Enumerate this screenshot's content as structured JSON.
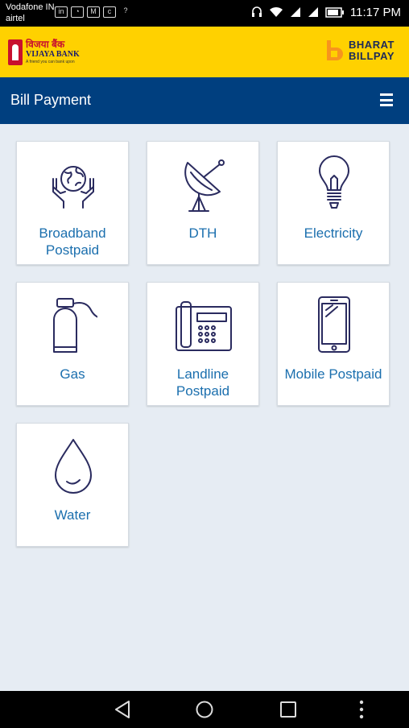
{
  "status_bar": {
    "carrier_line1": "Vodafone IN",
    "carrier_line2": "airtel",
    "time": "11:17 PM",
    "notification_icons": [
      "linkedin-icon",
      "whatsapp-icon",
      "gmail-icon",
      "citi-icon",
      "wifi-question-icon"
    ],
    "system_icons": [
      "headset-icon",
      "wifi-icon",
      "signal-icon",
      "signal-icon",
      "battery-icon"
    ]
  },
  "brand": {
    "bank_name_hindi": "विजया बैंक",
    "bank_name": "VIJAYA BANK",
    "bank_tagline": "A friend you can bank upon",
    "bbps_line1": "BHARAT",
    "bbps_line2": "BILLPAY"
  },
  "header": {
    "title": "Bill Payment",
    "menu_icon": "hamburger-menu-icon"
  },
  "categories": [
    {
      "label": "Broadband Postpaid",
      "icon": "globe-hands-icon"
    },
    {
      "label": "DTH",
      "icon": "satellite-dish-icon"
    },
    {
      "label": "Electricity",
      "icon": "light-bulb-icon"
    },
    {
      "label": "Gas",
      "icon": "gas-cylinder-icon"
    },
    {
      "label": "Landline Postpaid",
      "icon": "landline-phone-icon"
    },
    {
      "label": "Mobile Postpaid",
      "icon": "mobile-phone-icon"
    },
    {
      "label": "Water",
      "icon": "water-drop-icon"
    }
  ],
  "colors": {
    "brand_yellow": "#ffd100",
    "header_blue": "#003f7f",
    "label_blue": "#1b6fae",
    "icon_navy": "#2a2b5f",
    "background": "#e6ecf3"
  },
  "nav_bar": {
    "icons": [
      "back-icon",
      "home-icon",
      "recents-icon",
      "more-icon"
    ]
  }
}
